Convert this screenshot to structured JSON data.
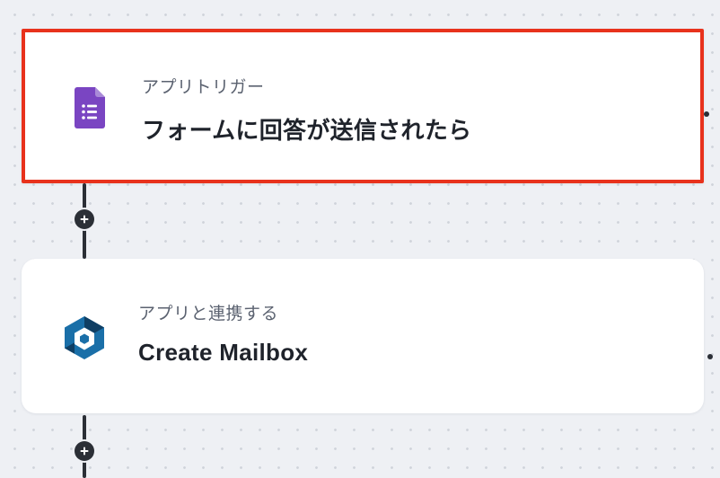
{
  "flow": {
    "steps": [
      {
        "label": "アプリトリガー",
        "title": "フォームに回答が送信されたら",
        "icon": "google-forms-icon",
        "selected": true,
        "highlight_color": "#e8321c",
        "icon_color": "#7a45c2"
      },
      {
        "label": "アプリと連携する",
        "title": "Create Mailbox",
        "icon": "mailbox-app-icon",
        "selected": false,
        "icon_colors": [
          "#1a6fa8",
          "#0f3e63"
        ]
      }
    ],
    "add_step_icon": "plus-icon"
  }
}
